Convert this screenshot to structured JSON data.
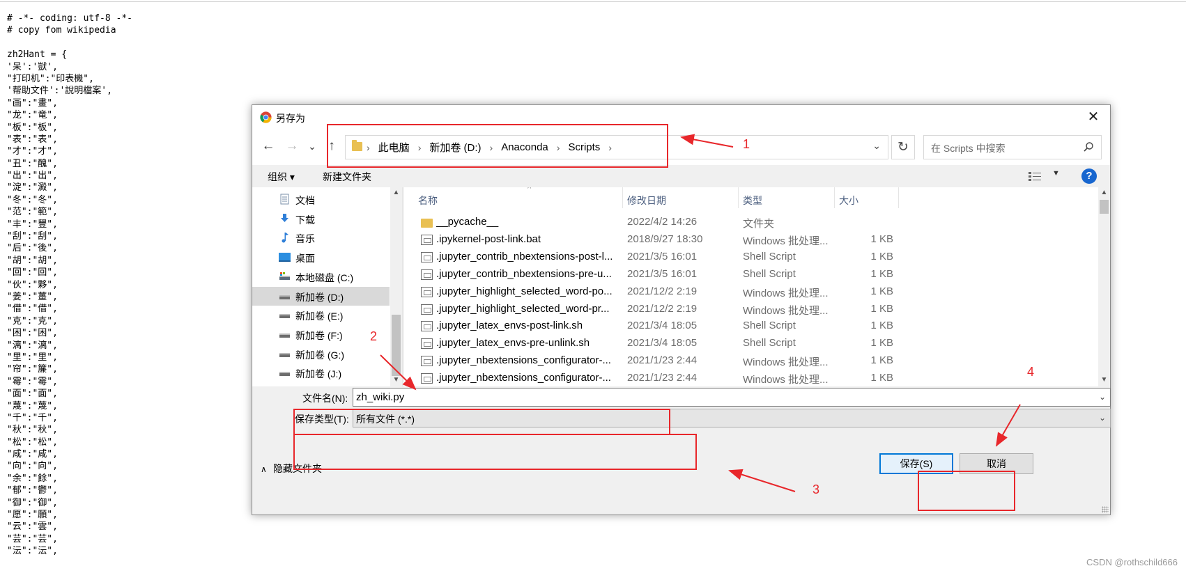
{
  "editor": {
    "lines": [
      "# -*- coding: utf-8 -*-",
      "# copy fom wikipedia",
      "",
      "zh2Hant = {",
      "'呆':'獃',",
      "\"打印机\":\"印表機\",",
      "'帮助文件':'說明檔案',",
      "\"画\":\"畫\",",
      "\"龙\":\"竜\",",
      "\"板\":\"板\",",
      "\"表\":\"表\",",
      "\"才\":\"才\",",
      "\"丑\":\"醜\",",
      "\"出\":\"出\",",
      "\"淀\":\"澱\",",
      "\"冬\":\"冬\",",
      "\"范\":\"範\",",
      "\"丰\":\"豐\",",
      "\"刮\":\"刮\",",
      "\"后\":\"後\",",
      "\"胡\":\"胡\",",
      "\"回\":\"回\",",
      "\"伙\":\"夥\",",
      "\"姜\":\"薑\",",
      "\"借\":\"借\",",
      "\"克\":\"克\",",
      "\"困\":\"困\",",
      "\"漓\":\"漓\",",
      "\"里\":\"里\",",
      "\"帘\":\"簾\",",
      "\"霉\":\"霉\",",
      "\"面\":\"面\",",
      "\"蔑\":\"蔑\",",
      "\"千\":\"千\",",
      "\"秋\":\"秋\",",
      "\"松\":\"松\",",
      "\"咸\":\"咸\",",
      "\"向\":\"向\",",
      "\"余\":\"餘\",",
      "\"郁\":\"鬱\",",
      "\"御\":\"御\",",
      "\"愿\":\"願\",",
      "\"云\":\"雲\",",
      "\"芸\":\"芸\",",
      "\"沄\":\"沄\","
    ]
  },
  "dialog": {
    "title": "另存为",
    "close": "✕",
    "nav": {
      "back": "←",
      "forward": "→",
      "recent": "⌄",
      "up": "↑"
    },
    "breadcrumbs": [
      "此电脑",
      "新加卷 (D:)",
      "Anaconda",
      "Scripts"
    ],
    "crumb_sep": "›",
    "addr_dropdown": "⌄",
    "refresh": "↻",
    "search_placeholder": "在 Scripts 中搜索",
    "organize": "组织 ▾",
    "new_folder": "新建文件夹",
    "view_dropdown": "▼",
    "help": "?",
    "sidebar": [
      {
        "label": "文档",
        "icon": "document-icon"
      },
      {
        "label": "下载",
        "icon": "download-icon"
      },
      {
        "label": "音乐",
        "icon": "music-icon"
      },
      {
        "label": "桌面",
        "icon": "desktop-icon"
      },
      {
        "label": "本地磁盘 (C:)",
        "icon": "drive-c-icon"
      },
      {
        "label": "新加卷 (D:)",
        "icon": "drive-icon",
        "selected": true
      },
      {
        "label": "新加卷 (E:)",
        "icon": "drive-icon"
      },
      {
        "label": "新加卷 (F:)",
        "icon": "drive-icon"
      },
      {
        "label": "新加卷 (G:)",
        "icon": "drive-icon"
      },
      {
        "label": "新加卷 (J:)",
        "icon": "drive-icon"
      }
    ],
    "columns": {
      "name": "名称",
      "date": "修改日期",
      "type": "类型",
      "size": "大小"
    },
    "sort_caret": "^",
    "files": [
      {
        "name": "__pycache__",
        "date": "2022/4/2 14:26",
        "type": "文件夹",
        "size": "",
        "kind": "folder"
      },
      {
        "name": ".ipykernel-post-link.bat",
        "date": "2018/9/27 18:30",
        "type": "Windows 批处理...",
        "size": "1 KB",
        "kind": "file"
      },
      {
        "name": ".jupyter_contrib_nbextensions-post-l...",
        "date": "2021/3/5 16:01",
        "type": "Shell Script",
        "size": "1 KB",
        "kind": "file"
      },
      {
        "name": ".jupyter_contrib_nbextensions-pre-u...",
        "date": "2021/3/5 16:01",
        "type": "Shell Script",
        "size": "1 KB",
        "kind": "file"
      },
      {
        "name": ".jupyter_highlight_selected_word-po...",
        "date": "2021/12/2 2:19",
        "type": "Windows 批处理...",
        "size": "1 KB",
        "kind": "file"
      },
      {
        "name": ".jupyter_highlight_selected_word-pr...",
        "date": "2021/12/2 2:19",
        "type": "Windows 批处理...",
        "size": "1 KB",
        "kind": "file"
      },
      {
        "name": ".jupyter_latex_envs-post-link.sh",
        "date": "2021/3/4 18:05",
        "type": "Shell Script",
        "size": "1 KB",
        "kind": "file"
      },
      {
        "name": ".jupyter_latex_envs-pre-unlink.sh",
        "date": "2021/3/4 18:05",
        "type": "Shell Script",
        "size": "1 KB",
        "kind": "file"
      },
      {
        "name": ".jupyter_nbextensions_configurator-...",
        "date": "2021/1/23 2:44",
        "type": "Windows 批处理...",
        "size": "1 KB",
        "kind": "file"
      },
      {
        "name": ".jupyter_nbextensions_configurator-...",
        "date": "2021/1/23 2:44",
        "type": "Windows 批处理...",
        "size": "1 KB",
        "kind": "file"
      }
    ],
    "filename_label": "文件名(N):",
    "filename_value": "zh_wiki.py",
    "filetype_label": "保存类型(T):",
    "filetype_value": "所有文件 (*.*)",
    "hide_folders": "隐藏文件夹",
    "save": "保存(S)",
    "cancel": "取消"
  },
  "annotations": [
    "1",
    "2",
    "3",
    "4"
  ],
  "accent_color": "#e8272b",
  "watermark": "CSDN @rothschild666"
}
